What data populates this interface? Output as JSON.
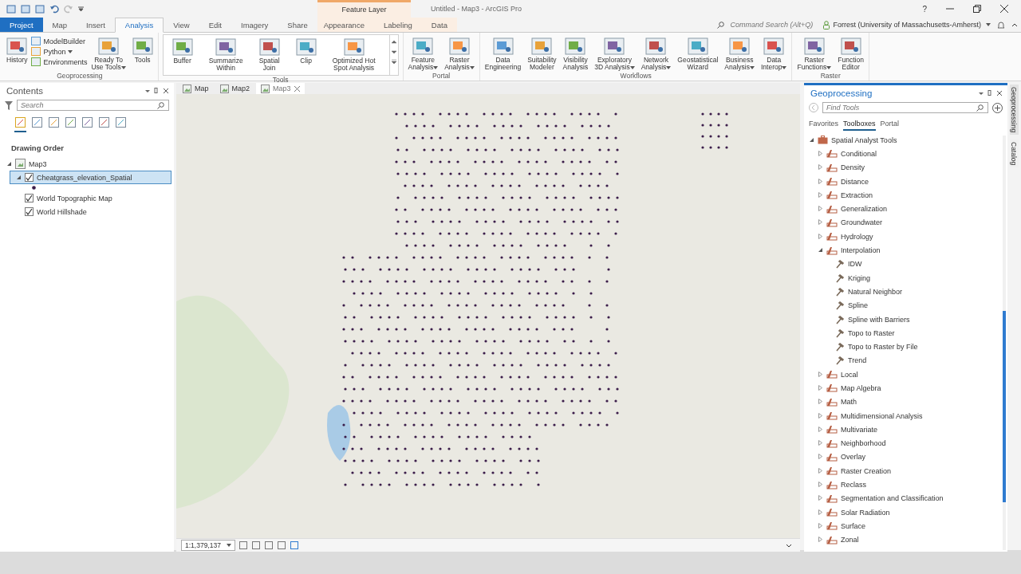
{
  "window": {
    "title": "Untitled - Map3 - ArcGIS Pro",
    "contextual_group": "Feature Layer",
    "help": "?"
  },
  "tabs": [
    {
      "label": "Project",
      "kind": "file",
      "selected": false
    },
    {
      "label": "Map",
      "kind": "normal",
      "selected": false
    },
    {
      "label": "Insert",
      "kind": "normal",
      "selected": false
    },
    {
      "label": "Analysis",
      "kind": "normal",
      "selected": true
    },
    {
      "label": "View",
      "kind": "normal",
      "selected": false
    },
    {
      "label": "Edit",
      "kind": "normal",
      "selected": false
    },
    {
      "label": "Imagery",
      "kind": "normal",
      "selected": false
    },
    {
      "label": "Share",
      "kind": "normal",
      "selected": false
    },
    {
      "label": "Appearance",
      "kind": "contextual",
      "selected": false
    },
    {
      "label": "Labeling",
      "kind": "contextual",
      "selected": false
    },
    {
      "label": "Data",
      "kind": "contextual",
      "selected": false
    }
  ],
  "command_search": {
    "placeholder": "Command Search (Alt+Q)"
  },
  "user": {
    "name": "Forrest (University of Massachusetts-Amherst)"
  },
  "ribbon": [
    {
      "label": "Geoprocessing",
      "gallery": false,
      "tools": [
        {
          "kind": "large",
          "lines": [
            "History"
          ],
          "dropdown": false
        },
        {
          "kind": "stack",
          "items": [
            {
              "label": "ModelBuilder",
              "dropdown": false
            },
            {
              "label": "Python",
              "dropdown": true
            },
            {
              "label": "Environments",
              "dropdown": false
            }
          ]
        },
        {
          "kind": "large",
          "lines": [
            "Ready To",
            "Use Tools"
          ],
          "dropdown": true
        },
        {
          "kind": "large",
          "lines": [
            "Tools"
          ],
          "dropdown": false
        }
      ]
    },
    {
      "label": "Tools",
      "gallery": true,
      "tools": [
        {
          "kind": "large",
          "lines": [
            "Buffer"
          ],
          "dropdown": false
        },
        {
          "kind": "large",
          "lines": [
            "Summarize",
            "Within"
          ],
          "dropdown": false
        },
        {
          "kind": "large",
          "lines": [
            "Spatial",
            "Join"
          ],
          "dropdown": false
        },
        {
          "kind": "large",
          "lines": [
            "Clip"
          ],
          "dropdown": false
        },
        {
          "kind": "large",
          "lines": [
            "Optimized Hot",
            "Spot Analysis"
          ],
          "dropdown": false
        }
      ]
    },
    {
      "label": "Portal",
      "gallery": false,
      "tools": [
        {
          "kind": "large",
          "lines": [
            "Feature",
            "Analysis"
          ],
          "dropdown": true
        },
        {
          "kind": "large",
          "lines": [
            "Raster",
            "Analysis"
          ],
          "dropdown": true
        }
      ]
    },
    {
      "label": "Workflows",
      "gallery": false,
      "tools": [
        {
          "kind": "large",
          "lines": [
            "Data",
            "Engineering"
          ],
          "dropdown": false
        },
        {
          "kind": "large",
          "lines": [
            "Suitability",
            "Modeler"
          ],
          "dropdown": false
        },
        {
          "kind": "large",
          "lines": [
            "Visibility",
            "Analysis"
          ],
          "dropdown": false
        },
        {
          "kind": "large",
          "lines": [
            "Exploratory",
            "3D Analysis"
          ],
          "dropdown": true
        },
        {
          "kind": "large",
          "lines": [
            "Network",
            "Analysis"
          ],
          "dropdown": true
        },
        {
          "kind": "large",
          "lines": [
            "Geostatistical",
            "Wizard"
          ],
          "dropdown": false
        },
        {
          "kind": "large",
          "lines": [
            "Business",
            "Analysis"
          ],
          "dropdown": true
        },
        {
          "kind": "large",
          "lines": [
            "Data",
            "Interop"
          ],
          "dropdown": true
        }
      ]
    },
    {
      "label": "Raster",
      "gallery": false,
      "tools": [
        {
          "kind": "large",
          "lines": [
            "Raster",
            "Functions"
          ],
          "dropdown": true
        },
        {
          "kind": "large",
          "lines": [
            "Function",
            "Editor"
          ],
          "dropdown": false
        }
      ]
    }
  ],
  "contents": {
    "title": "Contents",
    "search": {
      "placeholder": "Search"
    },
    "heading": "Drawing Order",
    "tree": [
      {
        "label": "Map3",
        "kind": "map",
        "expanded": true,
        "children": [
          {
            "label": "Cheatgrass_elevation_Spatial",
            "kind": "layer",
            "checked": true,
            "selected": true,
            "expanded": true
          },
          {
            "label": "World Topographic Map",
            "kind": "layer",
            "checked": true,
            "selected": false,
            "expanded": false
          },
          {
            "label": "World Hillshade",
            "kind": "layer",
            "checked": true,
            "selected": false,
            "expanded": false
          }
        ]
      }
    ]
  },
  "map_tabs": [
    {
      "label": "Map",
      "selected": false
    },
    {
      "label": "Map2",
      "selected": false
    },
    {
      "label": "Map3",
      "selected": true
    }
  ],
  "map": {
    "scale": "1:1,379,137"
  },
  "geoprocessing": {
    "title": "Geoprocessing",
    "search": {
      "placeholder": "Find Tools"
    },
    "tabs": [
      {
        "label": "Favorites",
        "selected": false
      },
      {
        "label": "Toolboxes",
        "selected": true
      },
      {
        "label": "Portal",
        "selected": false
      }
    ],
    "tree": [
      {
        "label": "Spatial Analyst Tools",
        "kind": "toolbox",
        "expanded": true,
        "children": [
          {
            "label": "Conditional",
            "kind": "toolset",
            "expanded": false
          },
          {
            "label": "Density",
            "kind": "toolset",
            "expanded": false
          },
          {
            "label": "Distance",
            "kind": "toolset",
            "expanded": false
          },
          {
            "label": "Extraction",
            "kind": "toolset",
            "expanded": false
          },
          {
            "label": "Generalization",
            "kind": "toolset",
            "expanded": false
          },
          {
            "label": "Groundwater",
            "kind": "toolset",
            "expanded": false
          },
          {
            "label": "Hydrology",
            "kind": "toolset",
            "expanded": false
          },
          {
            "label": "Interpolation",
            "kind": "toolset",
            "expanded": true,
            "children": [
              {
                "label": "IDW",
                "kind": "tool"
              },
              {
                "label": "Kriging",
                "kind": "tool"
              },
              {
                "label": "Natural Neighbor",
                "kind": "tool"
              },
              {
                "label": "Spline",
                "kind": "tool"
              },
              {
                "label": "Spline with Barriers",
                "kind": "tool"
              },
              {
                "label": "Topo to Raster",
                "kind": "tool"
              },
              {
                "label": "Topo to Raster by File",
                "kind": "tool"
              },
              {
                "label": "Trend",
                "kind": "tool"
              }
            ]
          },
          {
            "label": "Local",
            "kind": "toolset",
            "expanded": false
          },
          {
            "label": "Map Algebra",
            "kind": "toolset",
            "expanded": false
          },
          {
            "label": "Math",
            "kind": "toolset",
            "expanded": false
          },
          {
            "label": "Multidimensional Analysis",
            "kind": "toolset",
            "expanded": false
          },
          {
            "label": "Multivariate",
            "kind": "toolset",
            "expanded": false
          },
          {
            "label": "Neighborhood",
            "kind": "toolset",
            "expanded": false
          },
          {
            "label": "Overlay",
            "kind": "toolset",
            "expanded": false
          },
          {
            "label": "Raster Creation",
            "kind": "toolset",
            "expanded": false
          },
          {
            "label": "Reclass",
            "kind": "toolset",
            "expanded": false
          },
          {
            "label": "Segmentation and Classification",
            "kind": "toolset",
            "expanded": false
          },
          {
            "label": "Solar Radiation",
            "kind": "toolset",
            "expanded": false
          },
          {
            "label": "Surface",
            "kind": "toolset",
            "expanded": false
          },
          {
            "label": "Zonal",
            "kind": "toolset",
            "expanded": false
          }
        ]
      }
    ]
  },
  "side_tabs": [
    {
      "label": "Geoprocessing",
      "selected": true
    },
    {
      "label": "Catalog",
      "selected": false
    }
  ]
}
